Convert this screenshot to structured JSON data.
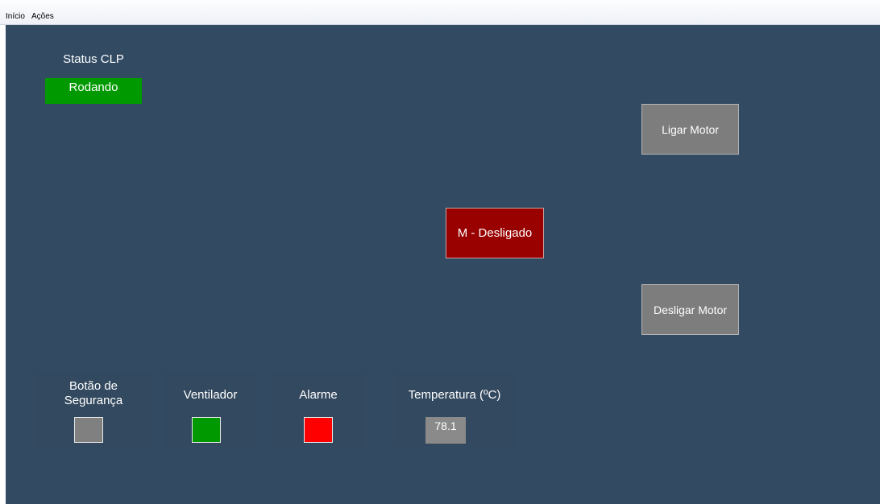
{
  "menu": {
    "items": [
      {
        "label": "Início"
      },
      {
        "label": "Ações"
      }
    ]
  },
  "status_clp": {
    "title": "Status CLP",
    "value": "Rodando",
    "color": "#009900"
  },
  "controls": {
    "ligar_label": "Ligar Motor",
    "desligar_label": "Desligar Motor"
  },
  "motor": {
    "state_label": "M - Desligado",
    "color": "#990000"
  },
  "indicators": {
    "botao_seguranca": {
      "label_line1": "Botão de",
      "label_line2": "Segurança",
      "color": "#808080"
    },
    "ventilador": {
      "label": "Ventilador",
      "color": "#009900"
    },
    "alarme": {
      "label": "Alarme",
      "color": "#ff0000"
    },
    "temperatura": {
      "label": "Temperatura (ºC)",
      "value": "78.1"
    }
  },
  "colors": {
    "background": "#324b63",
    "button": "#7d7d7d"
  }
}
